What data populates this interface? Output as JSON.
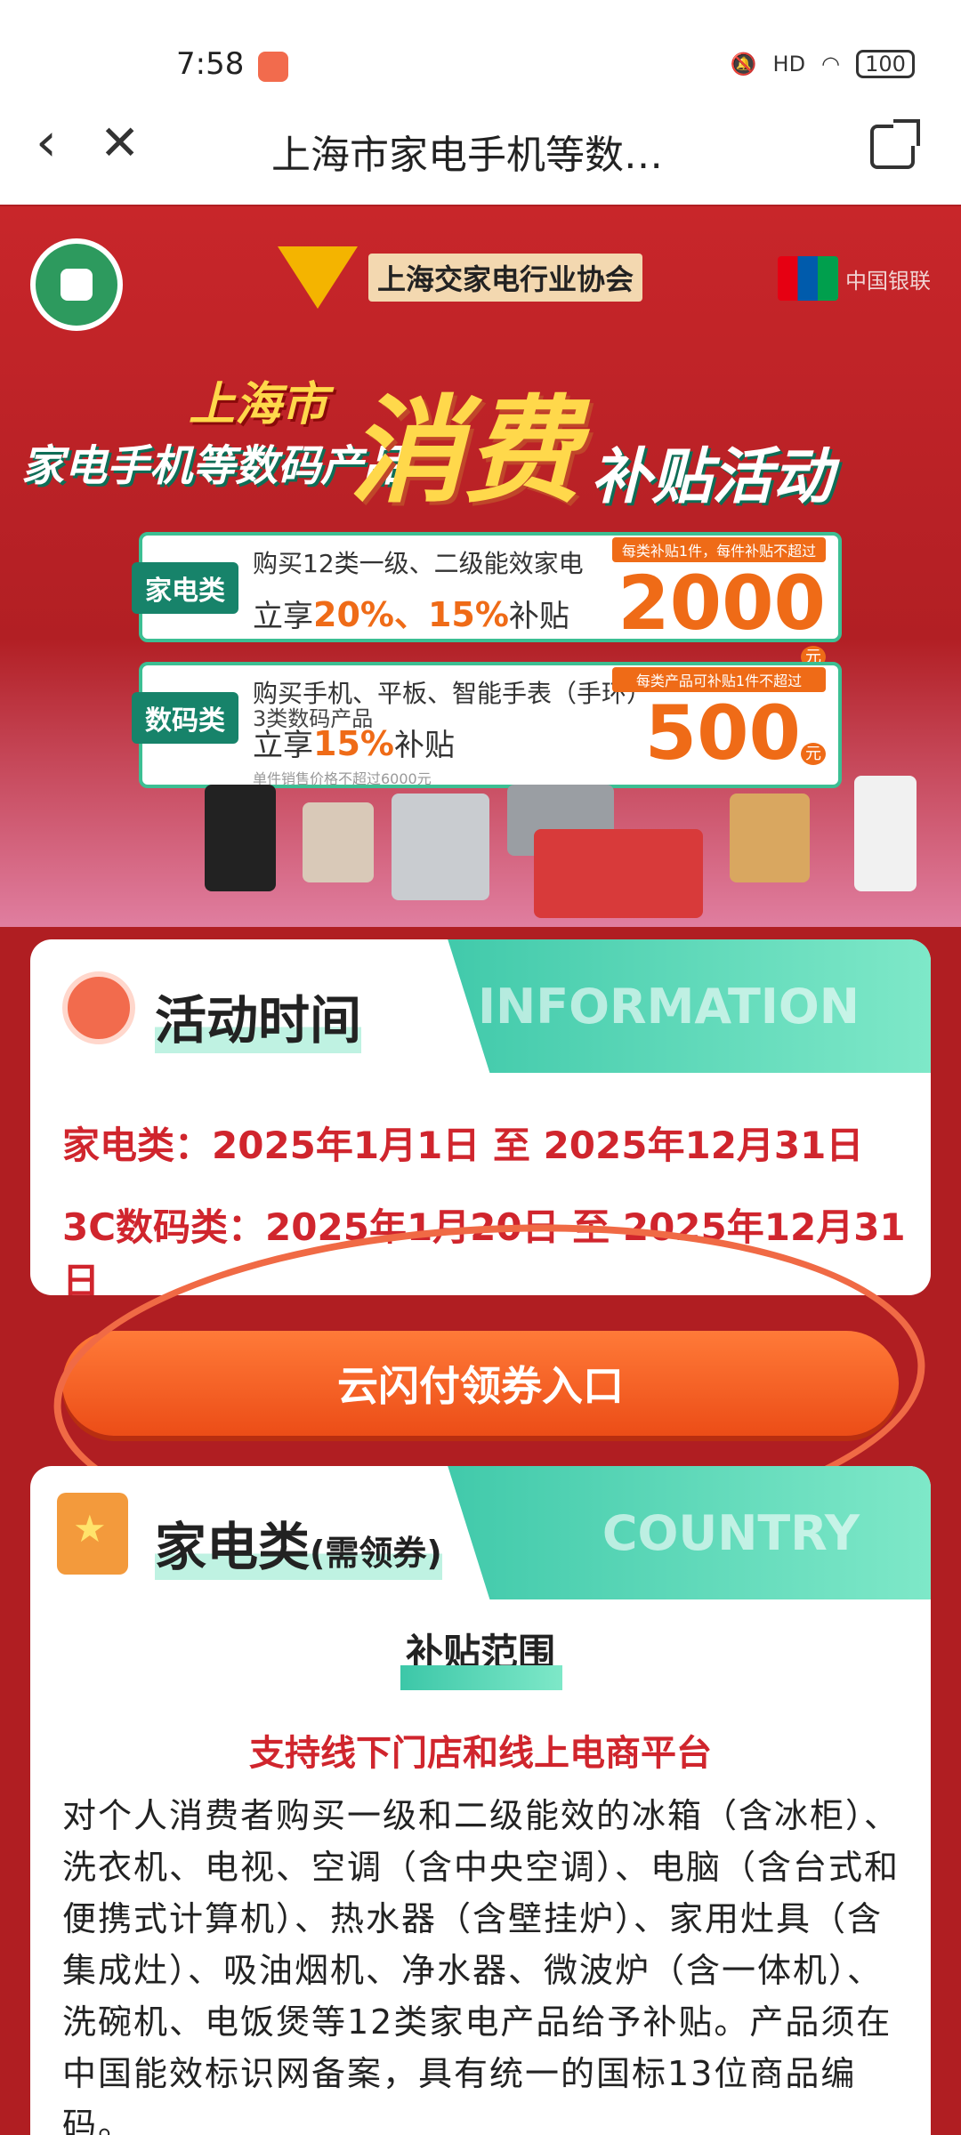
{
  "status_bar": {
    "time": "7:58",
    "signal": "HD",
    "battery": "100"
  },
  "nav": {
    "title": "上海市家电手机等数…"
  },
  "banner": {
    "association": "上海交家电行业协会",
    "unionpay": "中国银联",
    "headline_city": "上海市",
    "headline_sub": "家电手机等数码产品",
    "headline_big": "消费",
    "headline_rest": "补贴活动",
    "offer_appliance": {
      "tag": "家电类",
      "line1": "购买12类一级、二级能效家电",
      "line2_prefix": "立享",
      "line2_highlight": "20%、15%",
      "line2_suffix": "补贴",
      "note": "每类补贴1件，每件补贴不超过",
      "amount": "2000",
      "unit": "元"
    },
    "offer_digital": {
      "tag": "数码类",
      "line1": "购买手机、平板、智能手表（手环）",
      "line2": "3类数码产品",
      "line3_prefix": "立享",
      "line3_highlight": "15%",
      "line3_suffix": "补贴",
      "fine": "单件销售价格不超过6000元",
      "note": "每类产品可补贴1件不超过",
      "amount": "500",
      "unit": "元"
    }
  },
  "info_card": {
    "title": "活动时间",
    "en_label": "INFORMATION",
    "rows": [
      "家电类：2025年1月1日 至 2025年12月31日",
      "3C数码类：2025年1月20日 至 2025年12月31日"
    ]
  },
  "cta": {
    "label": "云闪付领券入口"
  },
  "country_card": {
    "title": "家电类",
    "title_note": "(需领券)",
    "en_label": "COUNTRY",
    "section_title": "补贴范围",
    "highlight": "支持线下门店和线上电商平台",
    "description": "对个人消费者购买一级和二级能效的冰箱（含冰柜）、洗衣机、电视、空调（含中央空调）、电脑（含台式和便携式计算机）、热水器（含壁挂炉）、家用灶具（含集成灶）、吸油烟机、净水器、微波炉（含一体机）、洗碗机、电饭煲等12类家电产品给予补贴。产品须在中国能效标识网备案，具有统一的国标13位商品编码。"
  }
}
